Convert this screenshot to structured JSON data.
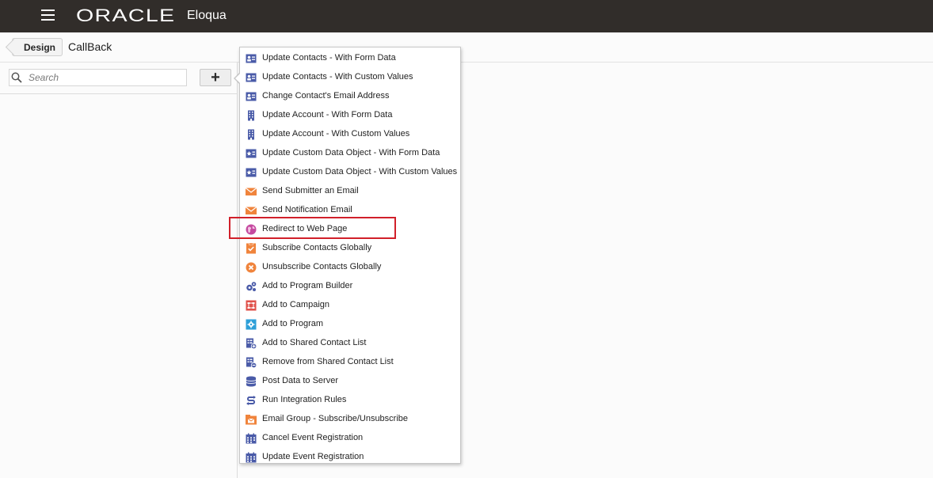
{
  "header": {
    "logo": "ORACLE",
    "app_name": "Eloqua"
  },
  "breadcrumb": {
    "back_label": "Design",
    "title": "CallBack"
  },
  "search": {
    "placeholder": "Search"
  },
  "add_button": {
    "label": "+"
  },
  "menu": {
    "items": [
      {
        "label": "Update Contacts - With Form Data",
        "icon": "contact-card-icon"
      },
      {
        "label": "Update Contacts - With Custom Values",
        "icon": "contact-card-icon"
      },
      {
        "label": "Change Contact's Email Address",
        "icon": "contact-card-icon"
      },
      {
        "label": "Update Account - With Form Data",
        "icon": "building-icon"
      },
      {
        "label": "Update Account - With Custom Values",
        "icon": "building-icon"
      },
      {
        "label": "Update Custom Data Object - With Form Data",
        "icon": "custom-object-icon"
      },
      {
        "label": "Update Custom Data Object - With Custom Values",
        "icon": "custom-object-icon"
      },
      {
        "label": "Send Submitter an Email",
        "icon": "envelope-icon"
      },
      {
        "label": "Send Notification Email",
        "icon": "envelope-icon"
      },
      {
        "label": "Redirect to Web Page",
        "icon": "globe-icon"
      },
      {
        "label": "Subscribe Contacts Globally",
        "icon": "subscribe-check-icon"
      },
      {
        "label": "Unsubscribe Contacts Globally",
        "icon": "unsubscribe-x-icon"
      },
      {
        "label": "Add to Program Builder",
        "icon": "gears-icon"
      },
      {
        "label": "Add to Campaign",
        "icon": "campaign-icon"
      },
      {
        "label": "Add to Program",
        "icon": "program-icon"
      },
      {
        "label": "Add to Shared Contact List",
        "icon": "list-add-icon"
      },
      {
        "label": "Remove from Shared Contact List",
        "icon": "list-remove-icon"
      },
      {
        "label": "Post Data to Server",
        "icon": "database-icon"
      },
      {
        "label": "Run Integration Rules",
        "icon": "integration-icon"
      },
      {
        "label": "Email Group - Subscribe/Unsubscribe",
        "icon": "email-group-icon"
      },
      {
        "label": "Cancel Event Registration",
        "icon": "calendar-icon"
      },
      {
        "label": "Update Event Registration",
        "icon": "calendar-icon"
      }
    ],
    "highlighted_item": "Redirect to Web Page"
  },
  "colors": {
    "header_bg": "#312d2a",
    "icon_blue": "#4a5ba8",
    "icon_orange": "#f0843c",
    "icon_pink": "#c54aa0",
    "icon_red": "#e0524b",
    "icon_teal": "#2d9fd8",
    "highlight_border": "#d1202a"
  }
}
